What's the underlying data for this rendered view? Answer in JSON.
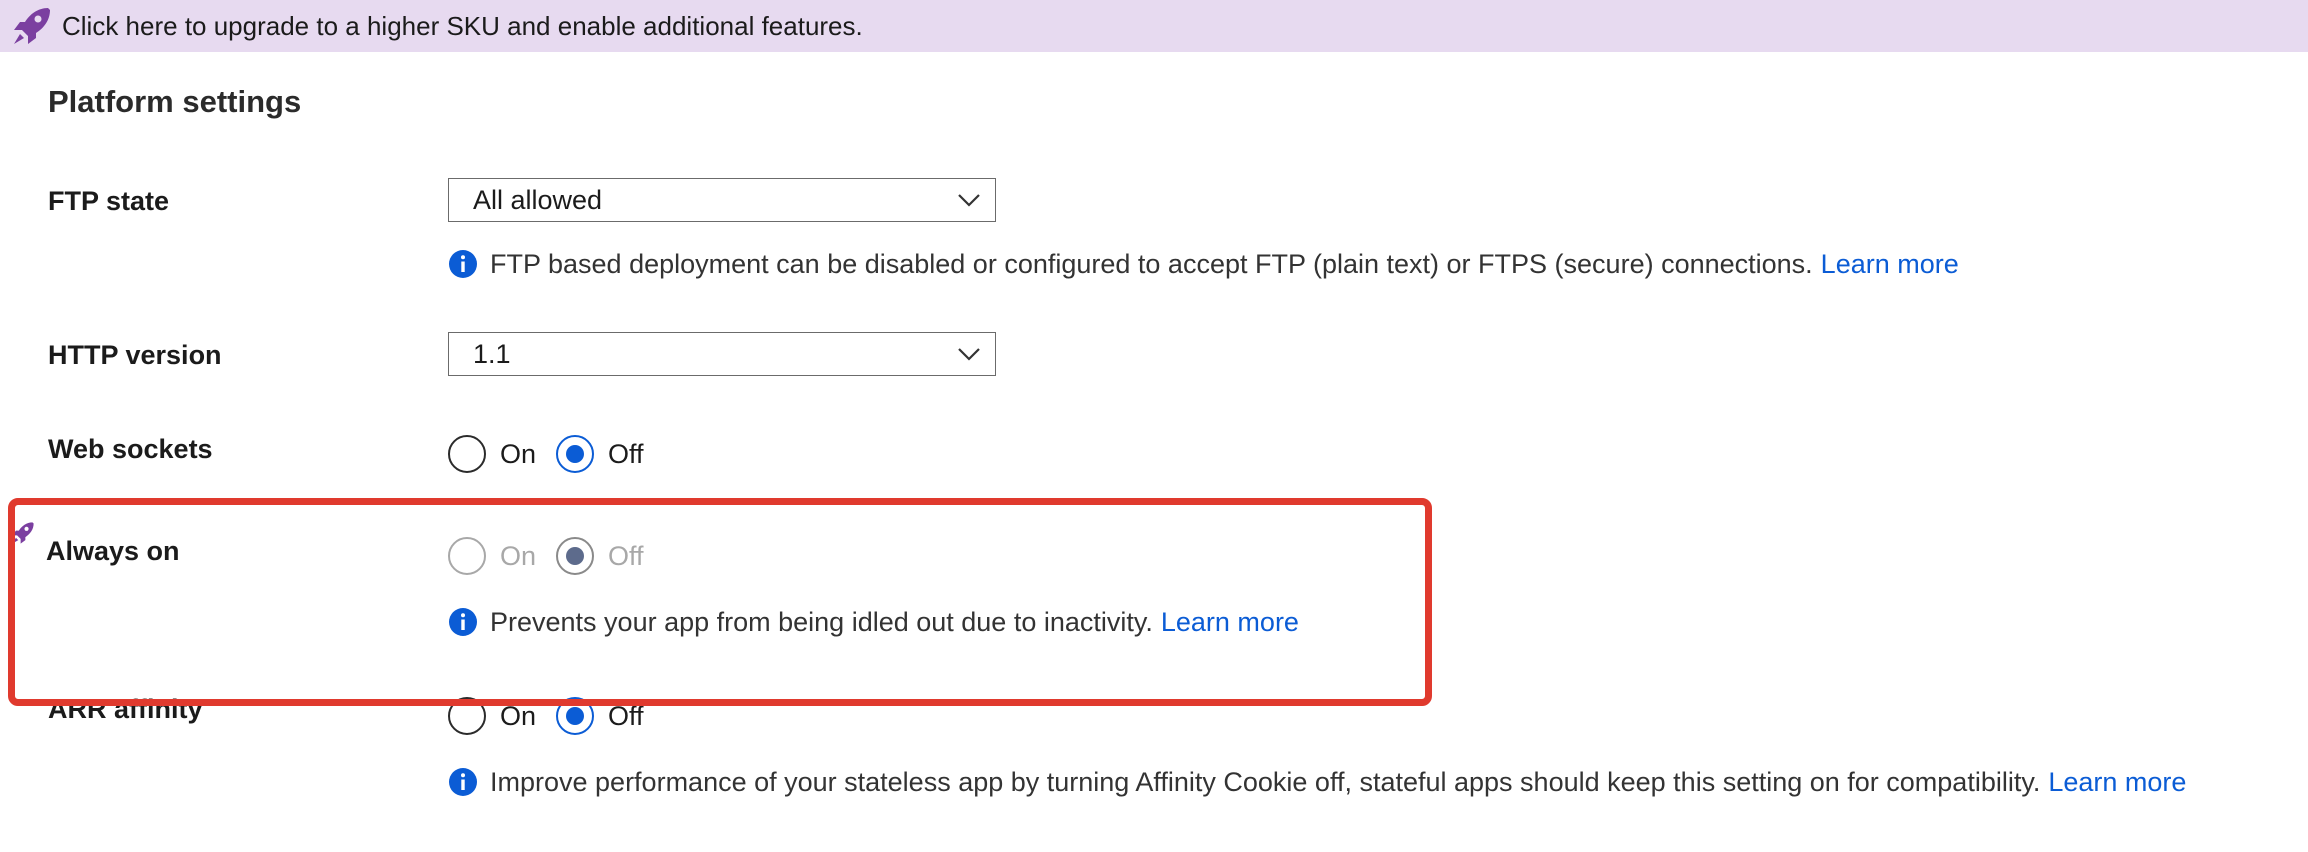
{
  "banner": {
    "text": "Click here to upgrade to a higher SKU and enable additional features.",
    "icon": "rocket-icon",
    "color": "#e7daf0"
  },
  "section": {
    "title": "Platform settings"
  },
  "ftp_state": {
    "label": "FTP state",
    "value": "All allowed",
    "info": "FTP based deployment can be disabled or configured to accept FTP (plain text) or FTPS (secure) connections.",
    "link": "Learn more"
  },
  "http_version": {
    "label": "HTTP version",
    "value": "1.1"
  },
  "web_sockets": {
    "label": "Web sockets",
    "on_label": "On",
    "off_label": "Off",
    "selected": "Off"
  },
  "always_on": {
    "label": "Always on",
    "on_label": "On",
    "off_label": "Off",
    "selected": "Off",
    "disabled": true,
    "info": "Prevents your app from being idled out due to inactivity.",
    "link": "Learn more"
  },
  "arr_affinity": {
    "label": "ARR affinity",
    "on_label": "On",
    "off_label": "Off",
    "selected": "Off",
    "info": "Improve performance of your stateless app by turning Affinity Cookie off, stateful apps should keep this setting on for compatibility.",
    "link": "Learn more"
  },
  "colors": {
    "accent": "#0b5cd5",
    "highlight": "#e03a2e",
    "rocket": "#7b3fa0"
  }
}
